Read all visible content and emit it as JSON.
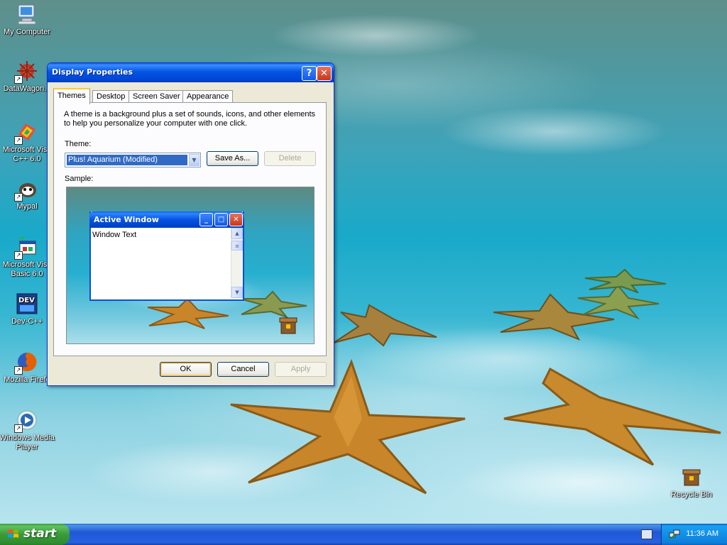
{
  "desktop": {
    "icons": [
      {
        "label": "My Computer",
        "icon": "my-computer-icon"
      },
      {
        "label": "DataWagon...",
        "icon": "datawagon-icon"
      },
      {
        "label": "Microsoft Visu C++ 6.0",
        "icon": "visual-cpp-icon"
      },
      {
        "label": "Mypal",
        "icon": "mypal-icon"
      },
      {
        "label": "Microsoft Visu Basic 6.0",
        "icon": "visual-basic-icon"
      },
      {
        "label": "Dev-C++",
        "icon": "dev-cpp-icon"
      },
      {
        "label": "Mozilla Firefo",
        "icon": "firefox-icon"
      },
      {
        "label": "Windows Media Player",
        "icon": "media-player-icon"
      },
      {
        "label": "Recycle Bin",
        "icon": "recycle-bin-icon"
      }
    ]
  },
  "dialog": {
    "title": "Display Properties",
    "help_button": "?",
    "close_button": "✕",
    "tabs": [
      {
        "label": "Themes",
        "active": true
      },
      {
        "label": "Desktop",
        "active": false
      },
      {
        "label": "Screen Saver",
        "active": false
      },
      {
        "label": "Appearance",
        "active": false
      }
    ],
    "description": "A theme is a background plus a set of sounds, icons, and other elements to help you personalize your computer with one click.",
    "theme_label": "Theme:",
    "theme_value": "Plus! Aquarium (Modified)",
    "save_as_label": "Save As...",
    "delete_label": "Delete",
    "sample_label": "Sample:",
    "sample": {
      "window_title": "Active Window",
      "window_text": "Window Text"
    },
    "ok_label": "OK",
    "cancel_label": "Cancel",
    "apply_label": "Apply"
  },
  "taskbar": {
    "start_label": "start",
    "clock": "11:36 AM"
  }
}
